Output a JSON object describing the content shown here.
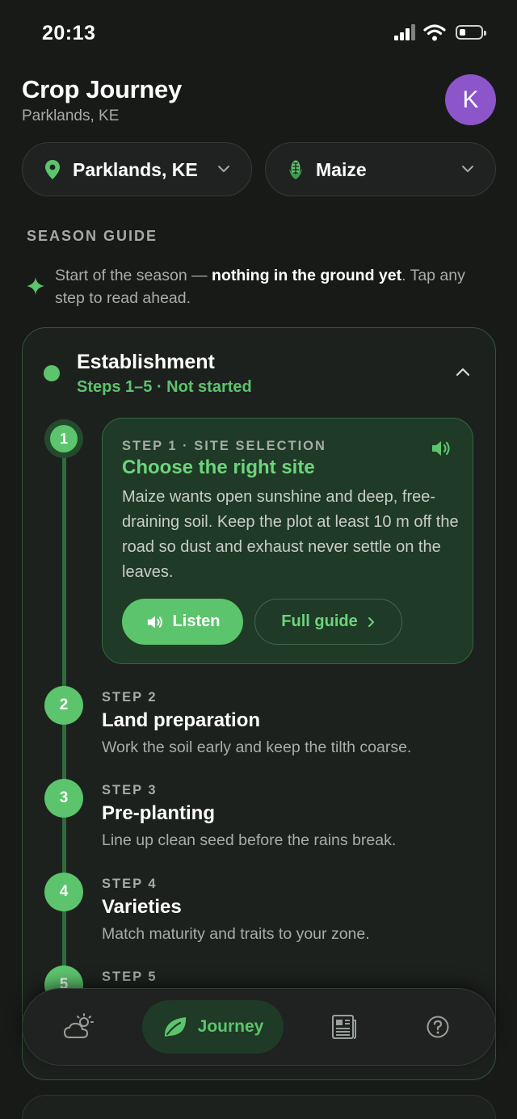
{
  "status_bar": {
    "time": "20:13"
  },
  "header": {
    "title": "Crop Journey",
    "subtitle": "Parklands, KE",
    "avatar_initial": "K"
  },
  "selectors": {
    "location": "Parklands, KE",
    "crop": "Maize"
  },
  "season_guide": {
    "label": "SEASON GUIDE",
    "hint_prefix": "Start of the season — ",
    "hint_bold": "nothing in the ground yet",
    "hint_suffix": ". Tap any step to read ahead."
  },
  "phase": {
    "title": "Establishment",
    "subtitle": "Steps 1–5 · Not started",
    "active_step": {
      "number": "1",
      "kicker": "STEP 1 · SITE SELECTION",
      "title": "Choose the right site",
      "body": "Maize wants open sunshine and deep, free-draining soil. Keep the plot at least 10 m off the road so dust and exhaust never settle on the leaves.",
      "listen_label": "Listen",
      "guide_label": "Full guide"
    },
    "steps": [
      {
        "number": "2",
        "kicker": "STEP 2",
        "title": "Land preparation",
        "desc": "Work the soil early and keep the tilth coarse."
      },
      {
        "number": "3",
        "kicker": "STEP 3",
        "title": "Pre-planting",
        "desc": "Line up clean seed before the rains break."
      },
      {
        "number": "4",
        "kicker": "STEP 4",
        "title": "Varieties",
        "desc": "Match maturity and traits to your zone."
      },
      {
        "number": "5",
        "kicker": "STEP 5",
        "title": "",
        "desc": ""
      }
    ]
  },
  "tabbar": {
    "journey_label": "Journey"
  },
  "colors": {
    "accent": "#5cc46c",
    "background": "#181a18",
    "avatar": "#8c55c9"
  },
  "icons": [
    "location-pin-icon",
    "corn-icon",
    "chevron-down-icon",
    "sparkle-icon",
    "chevron-up-icon",
    "speaker-icon",
    "chevron-right-icon",
    "weather-icon",
    "leaf-icon",
    "news-icon",
    "help-icon"
  ]
}
